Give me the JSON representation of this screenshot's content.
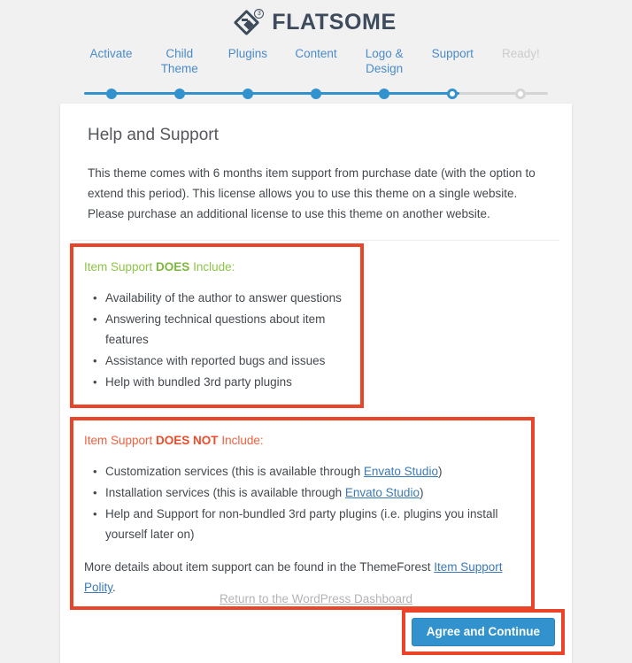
{
  "brand": {
    "name": "FLATSOME",
    "logo_icon": "flatsome-diamond-icon",
    "badge": "3",
    "color": "#3d4b5c"
  },
  "steps": {
    "items": [
      {
        "label": "Activate",
        "state": "done"
      },
      {
        "label": "Child Theme",
        "state": "done"
      },
      {
        "label": "Plugins",
        "state": "done"
      },
      {
        "label": "Content",
        "state": "done"
      },
      {
        "label": "Logo & Design",
        "state": "done"
      },
      {
        "label": "Support",
        "state": "current"
      },
      {
        "label": "Ready!",
        "state": "todo"
      }
    ],
    "active_color": "#3292ce",
    "inactive_color": "#d5d5d5"
  },
  "card": {
    "title": "Help and Support",
    "intro": "This theme comes with 6 months item support from purchase date (with the option to extend this period). This license allows you to use this theme on a single website. Please purchase an additional license to use this theme on another website.",
    "does": {
      "heading_prefix": "Item Support ",
      "heading_strong": "DOES",
      "heading_suffix": " Include:",
      "heading_color": "#8ec549",
      "items": [
        "Availability of the author to answer questions",
        "Answering technical questions about item features",
        "Assistance with reported bugs and issues",
        "Help with bundled 3rd party plugins"
      ]
    },
    "does_not": {
      "heading_prefix": "Item Support ",
      "heading_strong": "DOES NOT",
      "heading_suffix": " Include:",
      "heading_color": "#f0603e",
      "item1_before": "Customization services (this is available through ",
      "item1_link": "Envato Studio",
      "item1_after": ")",
      "item2_before": "Installation services (this is available through ",
      "item2_link": "Envato Studio",
      "item2_after": ")",
      "item3": "Help and Support for non-bundled 3rd party plugins (i.e. plugins you install yourself later on)",
      "more_before": "More details about item support can be found in the ThemeForest ",
      "more_link": "Item Support Polity",
      "more_after": "."
    },
    "agree_button": "Agree and Continue"
  },
  "highlight": {
    "color": "#ec4429"
  },
  "footer": {
    "return_link": "Return to the WordPress Dashboard"
  }
}
